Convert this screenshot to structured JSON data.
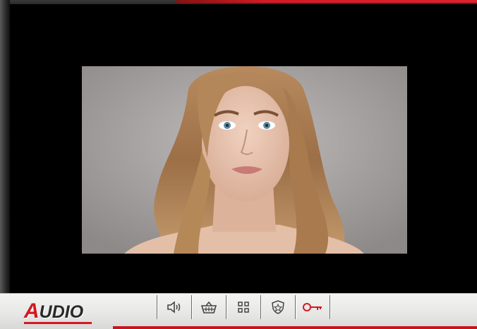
{
  "brand": {
    "logo_text": "UDIO",
    "logo_initial": "A",
    "accent": "#d11a22"
  },
  "video": {
    "content": "door-camera-portrait-feed"
  },
  "controls": [
    {
      "name": "speaker-icon"
    },
    {
      "name": "basket-icon"
    },
    {
      "name": "grid-menu-icon"
    },
    {
      "name": "badge-shield-icon"
    },
    {
      "name": "key-icon",
      "color": "#d11a22"
    }
  ]
}
